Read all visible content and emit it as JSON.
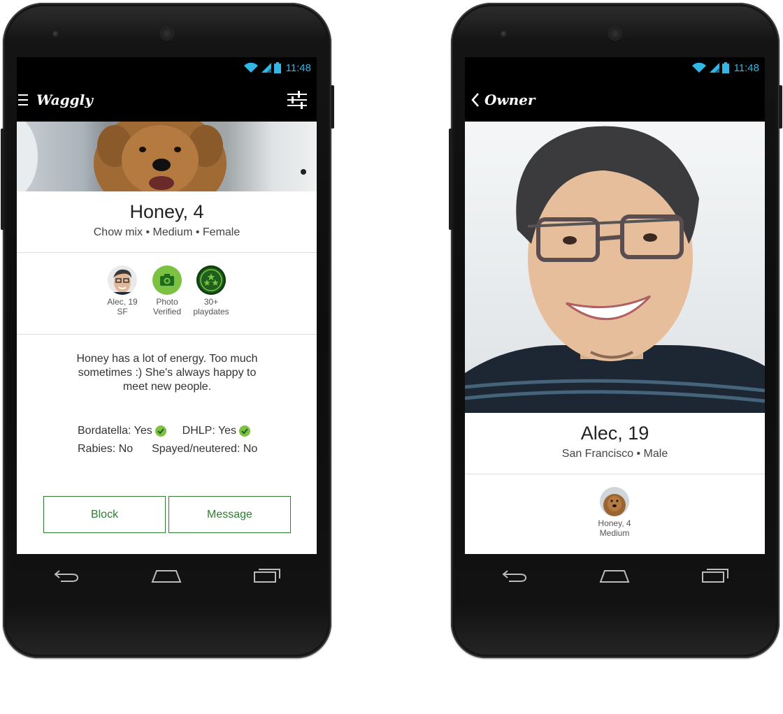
{
  "status_bar": {
    "time": "11:48"
  },
  "left_screen": {
    "app_title": "Waggly",
    "dog": {
      "name_age": "Honey, 4",
      "breed": "Chow mix",
      "size": "Medium",
      "sex": "Female"
    },
    "badges": [
      {
        "line1": "Alec, 19",
        "line2": "SF"
      },
      {
        "line1": "Photo",
        "line2": "Verified"
      },
      {
        "line1": "30+",
        "line2": "playdates"
      }
    ],
    "bio": "Honey has a lot of energy. Too much sometimes :) She's always happy to meet new people.",
    "vaccines": {
      "bordatella": "Bordatella: Yes",
      "dhlp": "DHLP: Yes",
      "rabies": "Rabies: No",
      "spayed": "Spayed/neutered: No"
    },
    "buttons": {
      "block": "Block",
      "message": "Message"
    }
  },
  "right_screen": {
    "back_title": "Owner",
    "owner": {
      "name_age": "Alec, 19",
      "city": "San Francisco",
      "sex": "Male"
    },
    "pet_badge": {
      "line1": "Honey, 4",
      "line2": "Medium"
    }
  },
  "colors": {
    "accent_green": "#2e7d32",
    "badge_green": "#7cc242",
    "status_blue": "#33b5e5"
  },
  "icons": {
    "menu": "hamburger-icon",
    "filter": "sliders-icon",
    "back": "chevron-left-icon",
    "wifi": "wifi-icon",
    "signal": "signal-icon",
    "battery": "battery-icon",
    "camera": "camera-icon",
    "stars": "stars-icon",
    "check": "check-icon",
    "nav_back": "nav-back-icon",
    "nav_home": "nav-home-icon",
    "nav_recents": "nav-recents-icon"
  }
}
